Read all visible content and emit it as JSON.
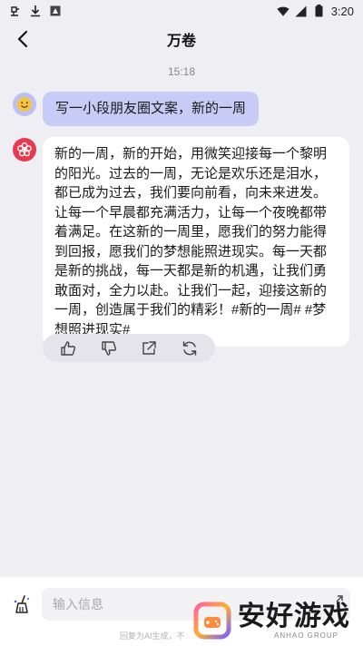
{
  "status_bar": {
    "time": "3:20",
    "left_icons": [
      "bug-icon",
      "download-icon",
      "image-icon"
    ],
    "right_icons": [
      "wifi-icon",
      "signal-icon",
      "battery-icon"
    ]
  },
  "header": {
    "title": "万卷"
  },
  "chat": {
    "timestamp": "15:18",
    "user_message": "写一小段朋友圈文案，新的一周",
    "ai_message": "新的一周，新的开始，用微笑迎接每一个黎明的阳光。过去的一周，无论是欢乐还是泪水，都已成为过去，我们要向前看，向未来进发。让每一个早晨都充满活力，让每一个夜晚都带着满足。在这新的一周里，愿我们的努力能得到回报，愿我们的梦想能照进现实。每一天都是新的挑战，每一天都是新的机遇，让我们勇敢面对，全力以赴。让我们一起，迎接这新的一周，创造属于我们的精彩！#新的一周# #梦想照进现实#",
    "actions": [
      "thumbs-up-icon",
      "thumbs-down-icon",
      "share-icon",
      "regenerate-icon"
    ]
  },
  "input": {
    "placeholder": "输入信息",
    "disclaimer": "回复为AI生成，不"
  },
  "watermark": {
    "name": "安好游戏",
    "sub": "ANHAO GROUP"
  },
  "colors": {
    "background": "#efeff3",
    "user_bubble": "#c9cbf7",
    "ai_avatar": "#e8394e",
    "user_avatar": "#bcc0f3"
  }
}
